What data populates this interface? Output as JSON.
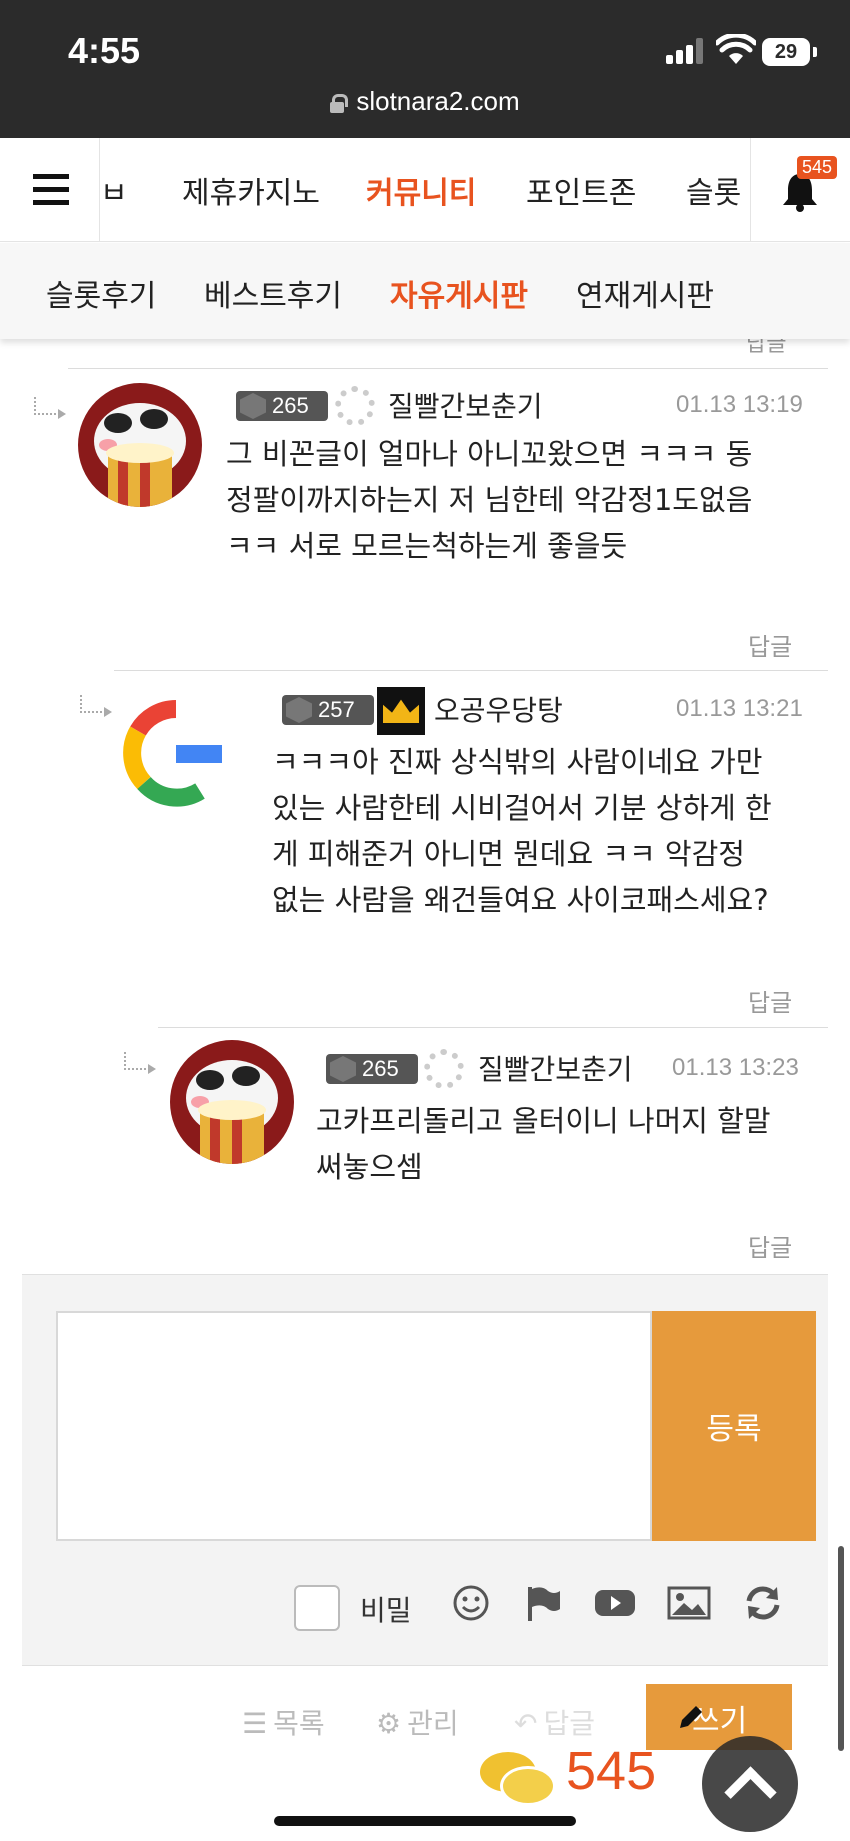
{
  "status_bar": {
    "time": "4:55",
    "battery": "29"
  },
  "browser": {
    "url": "slotnara2.com"
  },
  "top_nav": {
    "items": [
      "ㅂ",
      "제휴카지노",
      "커뮤니티",
      "포인트존",
      "슬롯"
    ],
    "active_index": 2,
    "notification_count": "545"
  },
  "sub_nav": {
    "items": [
      "슬롯후기",
      "베스트후기",
      "자유게시판",
      "연재게시판"
    ],
    "active_index": 2
  },
  "partial_reply_label": "답글",
  "comments": [
    {
      "level": "265",
      "nickname": "질빨간보춘기",
      "date": "01.13 13:19",
      "lines": [
        "그 비꼰글이 얼마나 아니꼬왔으면 ㅋㅋㅋ 동",
        "정팔이까지하는지 저 님한테 악감정1도없음",
        "ㅋㅋ 서로 모르는척하는게 좋을듯"
      ],
      "reply_label": "답글"
    },
    {
      "level": "257",
      "nickname": "오공우당탕",
      "date": "01.13 13:21",
      "lines": [
        "ㅋㅋㅋ아 진짜 상식밖의 사람이네요 가만",
        "있는 사람한테 시비걸어서 기분 상하게 한",
        "게 피해준거 아니면 뭔데요 ㅋㅋ 악감정",
        "없는 사람을 왜건들여요 사이코패스세요?"
      ],
      "reply_label": "답글"
    },
    {
      "level": "265",
      "nickname": "질빨간보춘기",
      "date": "01.13 13:23",
      "lines": [
        "고카프리돌리고 올터이니 나머지 할말",
        "써놓으셈"
      ],
      "reply_label": "답글"
    }
  ],
  "write_box": {
    "submit_label": "등록",
    "secret_label": "비밀",
    "tool_icons": [
      "smile-icon",
      "flag-icon",
      "youtube-icon",
      "image-icon",
      "refresh-icon"
    ]
  },
  "bottom_bar": {
    "list_label": "목록",
    "manage_label": "관리",
    "reply_label": "답글",
    "write_label": "쓰기",
    "chat_count": "545"
  },
  "colors": {
    "accent": "#e8531f",
    "button": "#e69a3c",
    "statusbar": "#2b2b2b"
  }
}
